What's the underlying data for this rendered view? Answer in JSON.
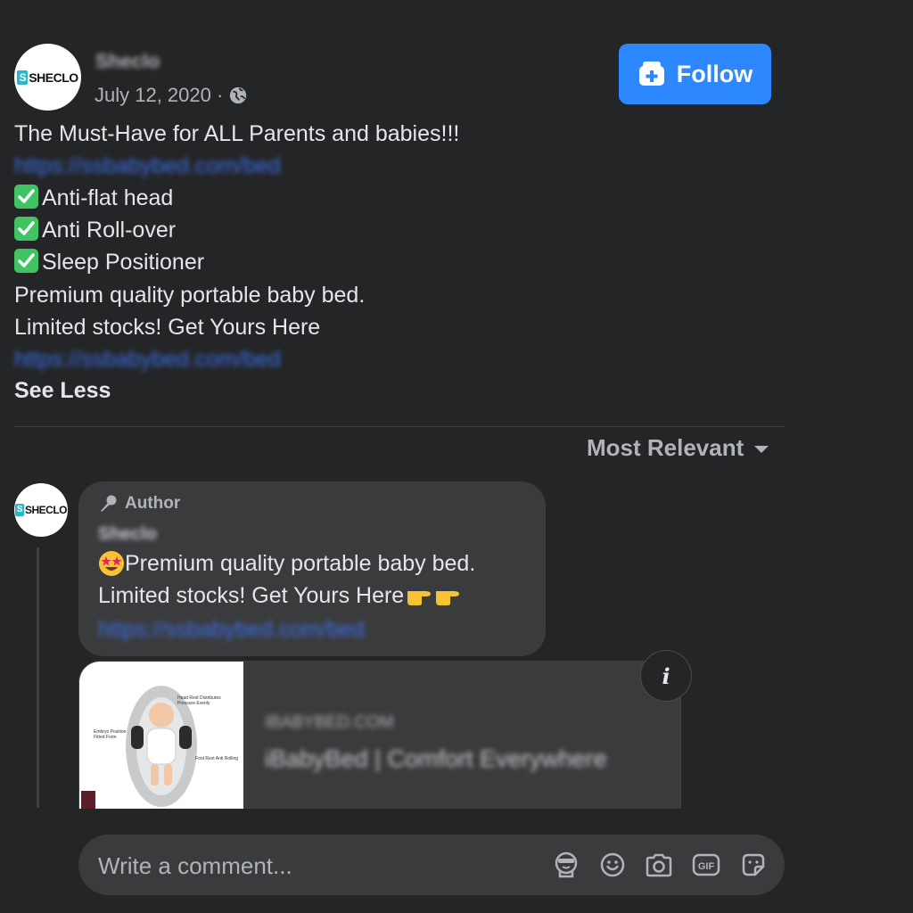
{
  "post": {
    "author_name": "Sheclo",
    "avatar_logo": "SHECLO",
    "date": "July 12, 2020 ·",
    "privacy_icon": "globe-icon",
    "follow_label": "Follow",
    "headline": "The Must-Have for ALL Parents and babies!!!",
    "link_1": "https://ssbabybed.com/bed",
    "features": [
      "Anti-flat head",
      "Anti Roll-over",
      "Sleep Positioner"
    ],
    "line_premium": "Premium quality portable baby bed.",
    "line_limited": "Limited stocks! Get Yours Here",
    "link_2": "https://ssbabybed.com/bed",
    "see_less": "See Less"
  },
  "comments": {
    "sort_label": "Most Relevant",
    "first": {
      "badge": "Author",
      "author_name": "Sheclo",
      "line_1": "Premium quality portable baby bed.",
      "line_2": "Limited stocks! Get Yours Here",
      "link": "https://ssbabybed.com/bed"
    },
    "preview": {
      "domain": "IBABYBED.COM",
      "title": "iBabyBed | Comfort Everywhere",
      "info_label": "i",
      "image_labels": [
        "Head Rest Distributes Pressure Evenly",
        "Embryo Position Fitted Form",
        "Foot Rest Anti Rolling"
      ]
    }
  },
  "composer": {
    "placeholder": "Write a comment...",
    "icons": [
      "avatar-sticker-icon",
      "emoji-icon",
      "camera-icon",
      "gif-icon",
      "sticker-icon"
    ]
  },
  "colors": {
    "background": "#242526",
    "bubble": "#3a3b3c",
    "accent": "#2d88ff",
    "link": "#3a6ee8",
    "check": "#40c463"
  }
}
